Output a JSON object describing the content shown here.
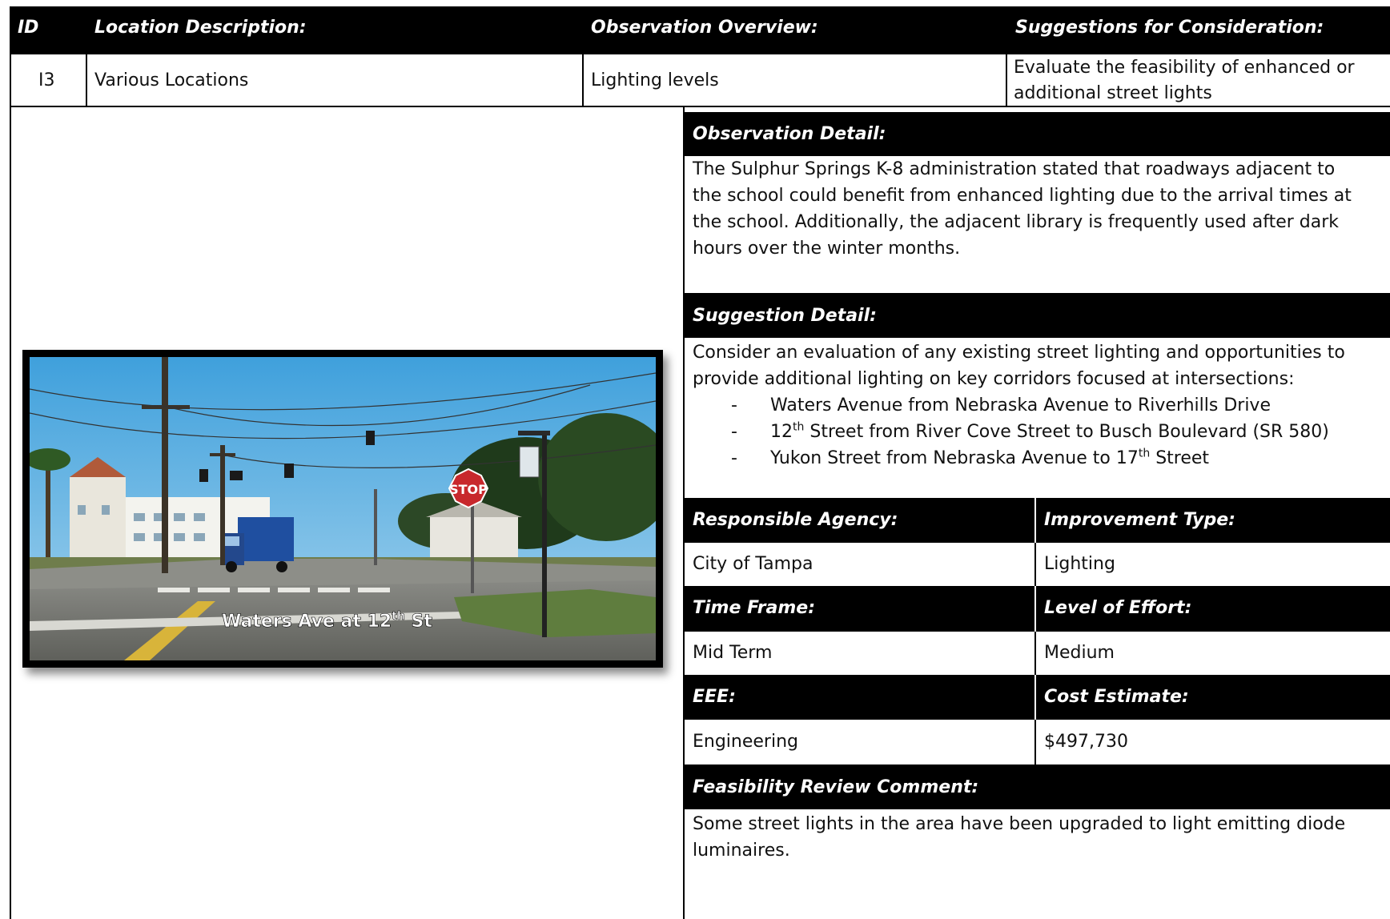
{
  "header": {
    "id": "ID",
    "location": "Location Description:",
    "observation": "Observation Overview:",
    "suggestions": "Suggestions for Consideration:"
  },
  "row": {
    "id": "I3",
    "location": "Various Locations",
    "observation": "Lighting levels",
    "suggestion": "Evaluate the feasibility of enhanced or additional street lights"
  },
  "photo": {
    "caption_main": "Waters Ave at 12",
    "caption_sup": "th",
    "caption_end": " St",
    "sign_text": "STOP"
  },
  "observation_detail": {
    "label": "Observation Detail:",
    "text": "The Sulphur Springs K-8 administration stated that roadways adjacent to the school could benefit from enhanced lighting due to the arrival times at the school. Additionally, the adjacent library is frequently used after dark hours over the winter months."
  },
  "suggestion_detail": {
    "label": "Suggestion Detail:",
    "text": "Consider an evaluation of any existing street lighting and opportunities to provide additional lighting on key corridors focused at intersections:",
    "dash": "-",
    "items": [
      {
        "pre": "Waters Avenue from Nebraska Avenue to Riverhills Drive",
        "sup": "",
        "post": ""
      },
      {
        "pre": "12",
        "sup": "th",
        "post": " Street from River Cove Street to Busch Boulevard (SR 580)"
      },
      {
        "pre": "Yukon Street from Nebraska Avenue to 17",
        "sup": "th",
        "post": " Street"
      }
    ]
  },
  "agency": {
    "label": "Responsible Agency:",
    "value": "City of Tampa"
  },
  "improvement": {
    "label": "Improvement Type:",
    "value": "Lighting"
  },
  "timeframe": {
    "label": "Time Frame:",
    "value": "Mid Term"
  },
  "effort": {
    "label": "Level of Effort:",
    "value": "Medium"
  },
  "eee": {
    "label": "EEE:",
    "value": "Engineering"
  },
  "cost": {
    "label": "Cost Estimate:",
    "value": "$497,730"
  },
  "feasibility": {
    "label": "Feasibility Review Comment:",
    "text": "Some street lights in the area have been upgraded to light emitting diode luminaires."
  }
}
